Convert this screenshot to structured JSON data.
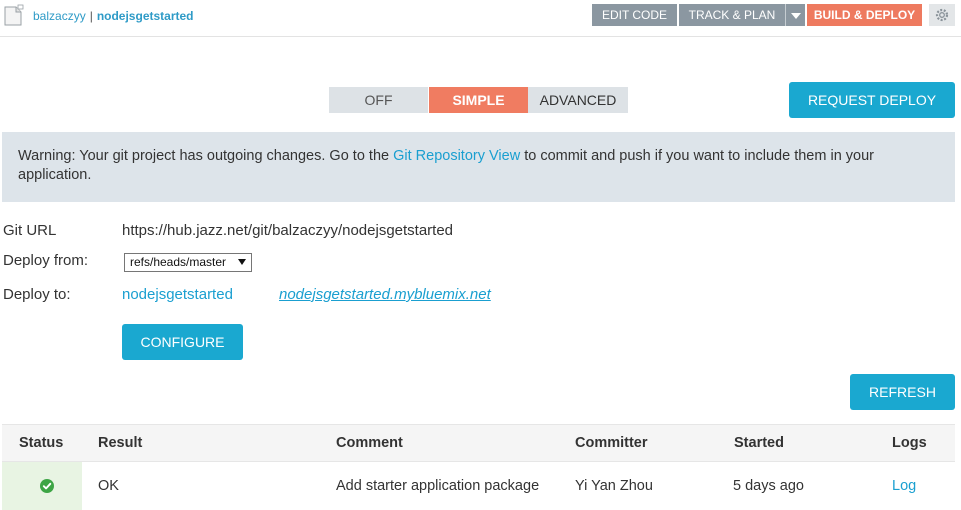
{
  "header": {
    "owner": "balzaczyy",
    "separator": "|",
    "project": "nodejsgetstarted",
    "nav": {
      "edit_code": "EDIT CODE",
      "track_plan": "TRACK & PLAN",
      "build_deploy": "BUILD & DEPLOY"
    }
  },
  "mode_toggle": {
    "off": "OFF",
    "simple": "SIMPLE",
    "advanced": "ADVANCED",
    "selected": "SIMPLE"
  },
  "request_deploy_label": "REQUEST DEPLOY",
  "warning": {
    "before": "Warning: Your git project has outgoing changes. Go to the ",
    "link": "Git Repository View",
    "after": " to commit and push if you want to include them in your application."
  },
  "config": {
    "git_url_label": "Git URL",
    "git_url": "https://hub.jazz.net/git/balzaczyy/nodejsgetstarted",
    "deploy_from_label": "Deploy from:",
    "deploy_from_value": "refs/heads/master",
    "deploy_to_label": "Deploy to:",
    "deploy_to_app": "nodejsgetstarted",
    "deploy_to_url": "nodejsgetstarted.mybluemix.net",
    "configure_label": "CONFIGURE"
  },
  "refresh_label": "REFRESH",
  "table": {
    "columns": [
      "Status",
      "Result",
      "Comment",
      "Committer",
      "Started",
      "Logs"
    ],
    "rows": [
      {
        "status": "success",
        "result": "OK",
        "comment": "Add starter application package",
        "committer": "Yi Yan Zhou",
        "started": "5 days ago",
        "logs": "Log"
      }
    ]
  },
  "colors": {
    "accent": "#1aa8d0",
    "build_deploy": "#ee7a5f",
    "nav_gray": "#8b97a1",
    "warning_bg": "#dde4ea",
    "success": "#3da545"
  },
  "icons": [
    "project-file-icon",
    "dropdown-arrow-icon",
    "gear-icon",
    "check-circle-icon"
  ]
}
